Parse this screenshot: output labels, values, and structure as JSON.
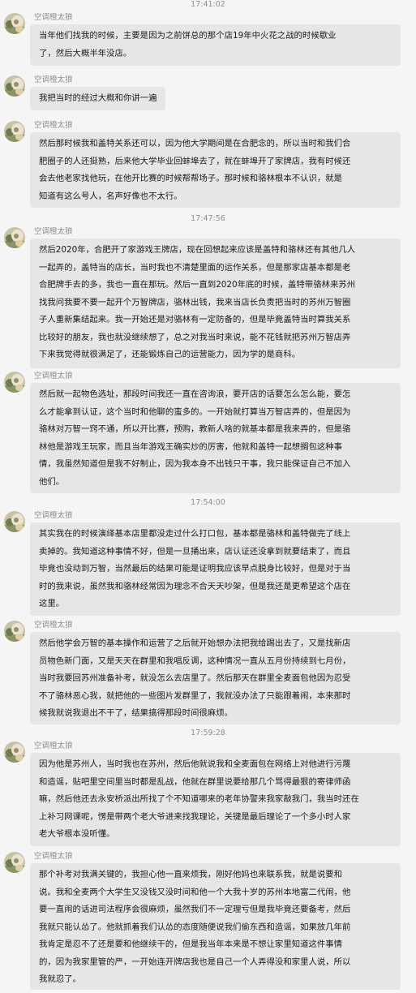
{
  "chat": {
    "items": [
      {
        "type": "timestamp",
        "text": "17:41:02"
      },
      {
        "type": "message",
        "sender": "空调橙太狼",
        "lines": [
          "当年他们找我的时候，主要是因为之前饼总的那个店19年中火花之战的时候歇业",
          "了，然后大概半年没店。"
        ]
      },
      {
        "type": "message",
        "sender": "空调橙太狼",
        "lines": [
          "我把当时的经过大概和你讲一遍"
        ]
      },
      {
        "type": "message",
        "sender": "空调橙太狼",
        "lines": [
          "然后那时候我和盖特关系还可以，因为他大学期间是在合肥念的，所以当时和我们合",
          "肥圈子的人还挺熟，后来他大学毕业回蚌埠去了，就在蚌埠开了家牌店，我有时候还",
          "会去他老家找他玩，在他开比赛的时候帮帮场子。那时候和骆林根本不认识，就是",
          "知道有这么号人，名声好像也不太行。"
        ]
      },
      {
        "type": "timestamp",
        "text": "17:47:56"
      },
      {
        "type": "message",
        "sender": "空调橙太狼",
        "lines": [
          "然后2020年，合肥开了家游戏王牌店，现在回想起来应该是盖特和骆林还有其他几人",
          "一起弄的，盖特当的店长，当时我也不清楚里面的运作关系，但是那家店基本都是老",
          "合肥牌手去的多，我也一直在那玩。然后一直到2020年底的时候，盖特带骆林来苏州",
          "找我问我要不要一起开个万智牌店，骆林出钱，我来当店长负责把当时的苏州万智圈",
          "子人重新集结起来。我一开始还是对骆林有一定防备的，但是毕竟盖特当时算我关系",
          "比较好的朋友，我也就没继续想了，总之对我当时来说，能不花钱就把苏州万智店弄",
          "下来我觉得就很满足了，还能锻炼自己的运营能力，因为学的是商科。"
        ]
      },
      {
        "type": "message",
        "sender": "空调橙太狼",
        "lines": [
          "然后就一起物色选址，那段时间我还一直在咨询浪，要开店的话要怎么怎么能，要怎",
          "么才能拿到认证，这个当时和他聊的蛮多的。一开始就打算当万智店弄的，但是因为",
          "骆林对万智一窍不通，所以开比赛，预购，教新人啥的就基本都是我来弄的，但是骆",
          "林他是游戏王玩家，而且当年游戏王确实炒的厉害，他就和盖特一起想搁包这种事",
          "情，我虽然知道但是我不好制止，因为我本身不出钱只干事，我只能保证自己不加入",
          "他们。"
        ]
      },
      {
        "type": "timestamp",
        "text": "17:54:00"
      },
      {
        "type": "message",
        "sender": "空调橙太狼",
        "lines": [
          "其实我在的时候演绎基本店里都没走过什么打口包，基本都是骆林和盖特做完了线上",
          "卖掉的。我知道这种事情不好，但是一旦捅出来，店认证还没拿到就要结束了，而且",
          "毕竟也没动到万智，当然最后的结果可能是证明我应该早点脱身比较好，但是对于当",
          "时的我来说，虽然我和骆林经常因为理念不合天天吵架，但是我还是更希望这个店在",
          "这里。"
        ]
      },
      {
        "type": "message",
        "sender": "空调橙太狼",
        "lines": [
          "然后他学会万智的基本操作和运营了之后就开始想办法把我给踢出去了，又是找新店",
          "员物色新门面，又是天天在群里和我唱反调，这种情况一直从五月份持续到七月份，",
          "当时我要回苏州准备补考，就没怎么去店里了。然后那天在群里全麦面包他因为忍受",
          "不了骆林恶心我，就把他的一些图片发群里了，我就没办法了只能跟着闹，本来那时",
          "候我就说我退出不干了，结果搞得那段时间很麻烦。"
        ]
      },
      {
        "type": "timestamp",
        "text": "17:59:28"
      },
      {
        "type": "message",
        "sender": "空调橙太狼",
        "lines": [
          "因为他是苏州人，当时我也在苏州，然后他就说我和全麦面包在网络上对他进行污蔑",
          "和造谣，贴吧里空间里当时都是乱战，他就在群里说要给那几个骂得最狠的寄律师函",
          "嘛，然后他还去永安桥派出所找了个不知道哪来的老年协警来我家敲我门，我当时还在",
          "上补习网课呢，愣是带两个老大爷进来找我理论，关键是最后理论了一个多小时人家",
          "老大爷根本没听懂。"
        ]
      },
      {
        "type": "message",
        "sender": "空调橙太狼",
        "lines": [
          "那个补考对我满关键的，我担心他一直来烦我，刚好他妈也来联系我，就是说要和",
          "说。我和全麦两个大学生又没钱又没时间和他一个大我十岁的苏州本地富二代闹，他",
          "要一直闹的话进司法程序会很麻烦，虽然我们不一定理亏但是我毕竟还要备考，然后",
          "我就只能认怂了。他就抓着我们认怂的态度随便说我们偷东西和造谣，如果放几年前",
          "我肯定是忍不了还是要和他继续干的，但是我当年本来是不想让家里知道这件事情",
          "的，因为我家里管的严，一开始连开牌店我也是自己一个人弄得没和家里人说，所以",
          "我就忍了。"
        ]
      }
    ]
  }
}
